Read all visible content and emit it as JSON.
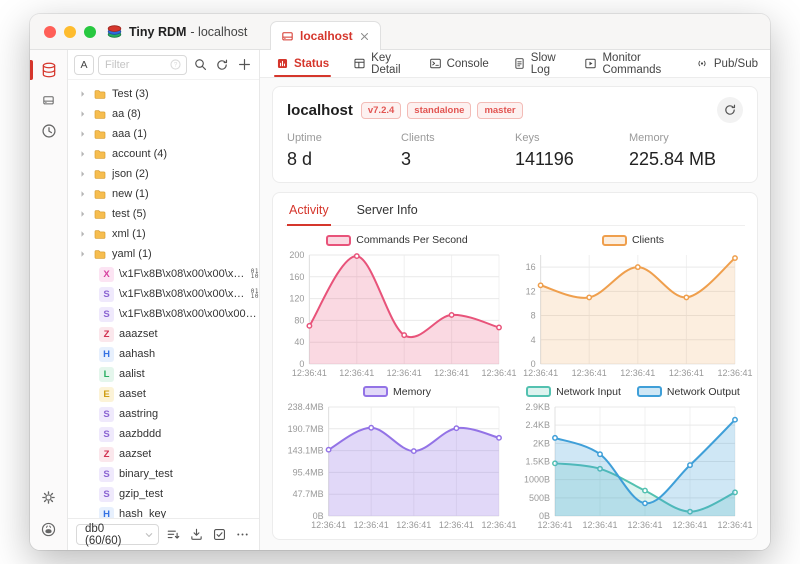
{
  "window": {
    "title": "Tiny RDM",
    "title_suffix": "- localhost",
    "accent_color": "#d5362c"
  },
  "rail": {
    "items": [
      {
        "name": "database",
        "icon": "database-icon",
        "active": true
      },
      {
        "name": "server",
        "icon": "server-icon",
        "active": false
      },
      {
        "name": "history",
        "icon": "history-icon",
        "active": false
      }
    ],
    "bottom_items": [
      {
        "name": "settings",
        "icon": "gear-icon"
      },
      {
        "name": "github",
        "icon": "github-icon"
      }
    ]
  },
  "sidebar": {
    "filter": {
      "prefix": "A",
      "placeholder": "Filter"
    },
    "tree": [
      {
        "name": "Test",
        "count": 3
      },
      {
        "name": "aa",
        "count": 8
      },
      {
        "name": "aaa",
        "count": 1
      },
      {
        "name": "account",
        "count": 4
      },
      {
        "name": "json",
        "count": 2
      },
      {
        "name": "new",
        "count": 1
      },
      {
        "name": "test",
        "count": 5
      },
      {
        "name": "xml",
        "count": 1
      },
      {
        "name": "yaml",
        "count": 1
      }
    ],
    "keys": [
      {
        "type": "X",
        "label": "\\x1F\\x8B\\x08\\x00\\x00\\x00\\x0...",
        "binary": true
      },
      {
        "type": "S",
        "label": "\\x1F\\x8B\\x08\\x00\\x00\\x09n\\x8...",
        "binary": true
      },
      {
        "type": "S",
        "label": "\\x1F\\x8B\\x08\\x00\\x00\\x00\\x00\\x0...",
        "binary": false
      },
      {
        "type": "Z",
        "label": "aaazset",
        "binary": false
      },
      {
        "type": "H",
        "label": "aahash",
        "binary": false
      },
      {
        "type": "L",
        "label": "aalist",
        "binary": false
      },
      {
        "type": "E",
        "label": "aaset",
        "binary": false
      },
      {
        "type": "S",
        "label": "aastring",
        "binary": false
      },
      {
        "type": "S",
        "label": "aazbddd",
        "binary": false
      },
      {
        "type": "Z",
        "label": "aazset",
        "binary": false
      },
      {
        "type": "S",
        "label": "binary_test",
        "binary": false
      },
      {
        "type": "S",
        "label": "gzip_test",
        "binary": false
      },
      {
        "type": "H",
        "label": "hash_key",
        "binary": false
      }
    ],
    "footer": {
      "db_label": "db0 (60/60)"
    }
  },
  "main": {
    "tab": {
      "label": "localhost"
    },
    "nav_tabs": [
      {
        "label": "Status",
        "icon": "status-icon",
        "active": true
      },
      {
        "label": "Key Detail",
        "icon": "key-detail-icon",
        "active": false
      },
      {
        "label": "Console",
        "icon": "console-icon",
        "active": false
      },
      {
        "label": "Slow Log",
        "icon": "slowlog-icon",
        "active": false
      },
      {
        "label": "Monitor Commands",
        "icon": "monitor-commands-icon",
        "active": false
      },
      {
        "label": "Pub/Sub",
        "icon": "pubsub-icon",
        "active": false
      }
    ]
  },
  "server": {
    "name": "localhost",
    "badges": [
      "v7.2.4",
      "standalone",
      "master"
    ],
    "stats": [
      {
        "label": "Uptime",
        "value": "8 d"
      },
      {
        "label": "Clients",
        "value": "3"
      },
      {
        "label": "Keys",
        "value": "141196"
      },
      {
        "label": "Memory",
        "value": "225.84 MB"
      }
    ]
  },
  "activity": {
    "tabs": [
      {
        "label": "Activity",
        "active": true
      },
      {
        "label": "Server Info",
        "active": false
      }
    ]
  },
  "chart_data": [
    {
      "type": "line",
      "title": "Commands Per Second",
      "x": [
        "12:36:41",
        "12:36:41",
        "12:36:41",
        "12:36:41",
        "12:36:41"
      ],
      "yticks": [
        "0",
        "40",
        "80",
        "120",
        "160",
        "200"
      ],
      "ytick_values": [
        0,
        40,
        80,
        120,
        160,
        200
      ],
      "ylim": [
        0,
        200
      ],
      "grid": true,
      "legend_position": "top",
      "series": [
        {
          "name": "Commands Per Second",
          "color": "#e8537a",
          "fill": "rgba(232,83,122,0.22)",
          "values": [
            70,
            198,
            53,
            90,
            67
          ]
        }
      ]
    },
    {
      "type": "line",
      "title": "Clients",
      "x": [
        "12:36:41",
        "12:36:41",
        "12:36:41",
        "12:36:41",
        "12:36:41"
      ],
      "yticks": [
        "0",
        "4",
        "8",
        "12",
        "16"
      ],
      "ytick_values": [
        0,
        4,
        8,
        12,
        16
      ],
      "ylim": [
        0,
        18
      ],
      "grid": true,
      "legend_position": "top",
      "series": [
        {
          "name": "Clients",
          "color": "#ef9f4d",
          "fill": "rgba(239,159,77,0.18)",
          "values": [
            13,
            11,
            16,
            11,
            17.5
          ]
        }
      ]
    },
    {
      "type": "line",
      "title": "Memory",
      "x": [
        "12:36:41",
        "12:36:41",
        "12:36:41",
        "12:36:41",
        "12:36:41"
      ],
      "yticks": [
        "0B",
        "47.7MB",
        "95.4MB",
        "143.1MB",
        "190.7MB",
        "238.4MB"
      ],
      "ytick_values": [
        0,
        47.7,
        95.4,
        143.1,
        190.7,
        238.4
      ],
      "ylim": [
        0,
        238.4
      ],
      "grid": true,
      "legend_position": "top",
      "series": [
        {
          "name": "Memory",
          "color": "#9373e6",
          "fill": "rgba(147,115,230,0.28)",
          "values": [
            145,
            193,
            142,
            192,
            171
          ]
        }
      ]
    },
    {
      "type": "line",
      "title": "Network",
      "x": [
        "12:36:41",
        "12:36:41",
        "12:36:41",
        "12:36:41",
        "12:36:41"
      ],
      "yticks": [
        "0B",
        "500B",
        "1000B",
        "1.5KB",
        "2KB",
        "2.4KB",
        "2.9KB"
      ],
      "ytick_values": [
        0,
        500,
        1000,
        1500,
        2000,
        2500,
        3000
      ],
      "ylim": [
        0,
        3000
      ],
      "grid": true,
      "legend_position": "top",
      "series": [
        {
          "name": "Network Input",
          "color": "#53c1b0",
          "fill": "rgba(83,193,176,0.20)",
          "values": [
            1450,
            1300,
            700,
            120,
            650
          ]
        },
        {
          "name": "Network Output",
          "color": "#3f9fd8",
          "fill": "rgba(63,159,216,0.25)",
          "values": [
            2150,
            1700,
            350,
            1400,
            2650
          ]
        }
      ]
    }
  ]
}
